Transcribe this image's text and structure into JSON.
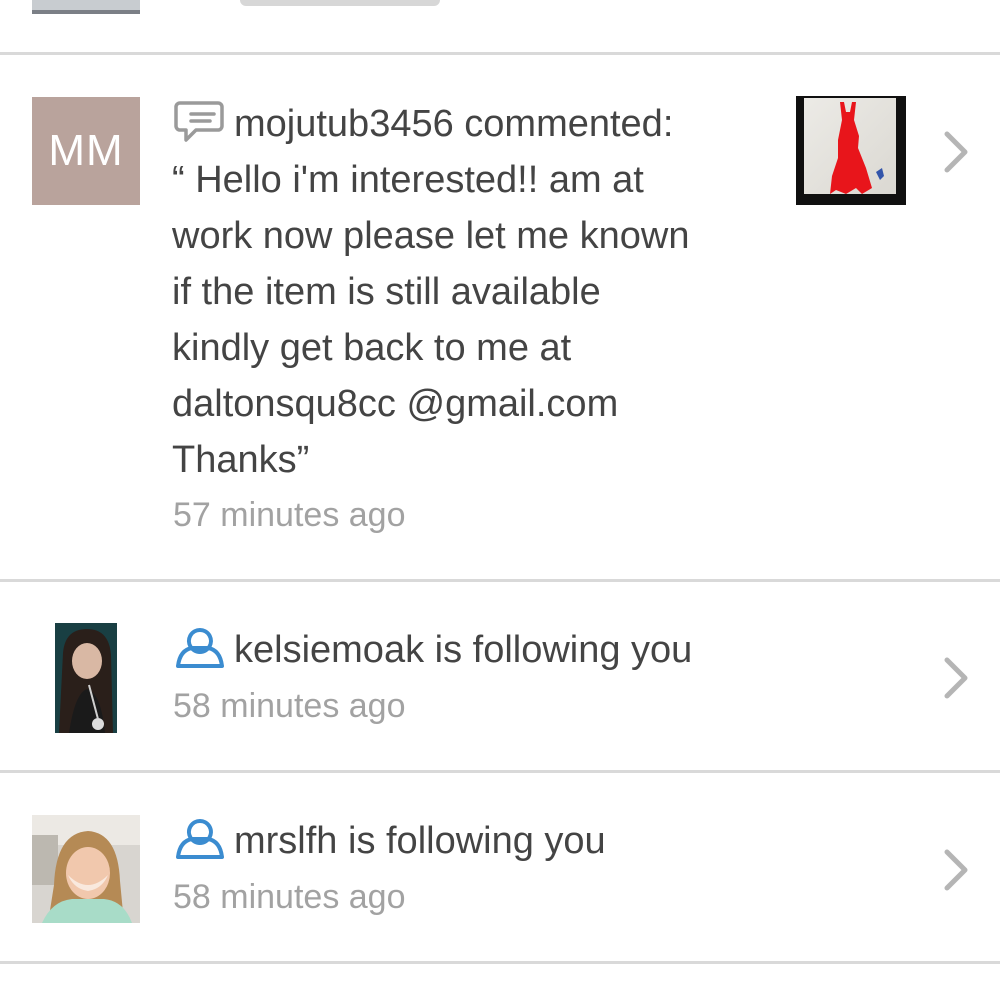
{
  "colors": {
    "text": "#444444",
    "muted": "#a2a2a2",
    "icon_blue": "#3b8cd0",
    "divider": "#d9d9d9",
    "initials_bg": "#b9a39c"
  },
  "notifications": [
    {
      "type": "comment",
      "icon": "comment-bubble-icon",
      "avatar_initials": "MM",
      "headline": "mojutub3456 commented:",
      "comment_lines": [
        "“ Hello i'm interested!! am at",
        "work now please let me known",
        "if the item is still available",
        "kindly get back to me at",
        "daltonsqu8cc @gmail.com",
        "Thanks”"
      ],
      "time": "57 minutes ago"
    },
    {
      "type": "follow",
      "icon": "follow-user-icon",
      "headline": "kelsiemoak is following you",
      "time": "58 minutes ago"
    },
    {
      "type": "follow",
      "icon": "follow-user-icon",
      "headline": "mrslfh is following you",
      "time": "58 minutes ago"
    }
  ]
}
